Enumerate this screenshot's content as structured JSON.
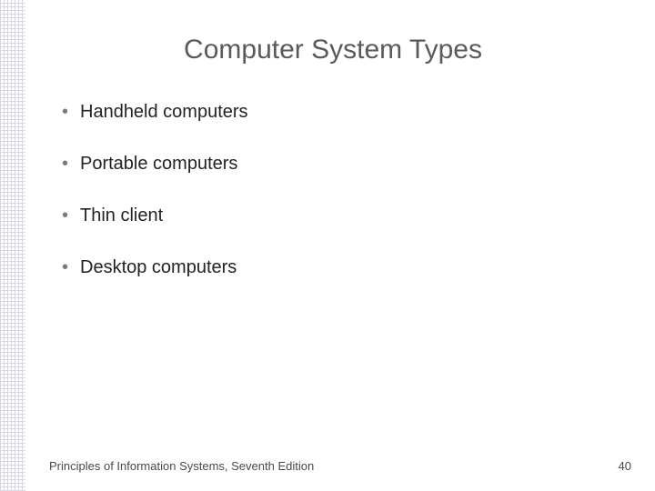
{
  "title": "Computer System Types",
  "bullets": [
    "Handheld computers",
    "Portable computers",
    "Thin client",
    "Desktop computers"
  ],
  "footer": {
    "text": "Principles of Information Systems, Seventh Edition",
    "page": "40"
  }
}
